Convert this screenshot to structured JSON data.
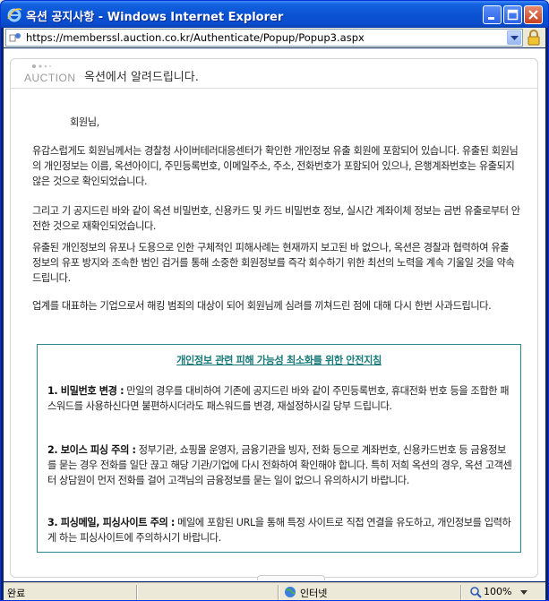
{
  "window": {
    "title": "옥션 공지사항 - Windows Internet Explorer"
  },
  "address": {
    "url": "https://memberssl.auction.co.kr/Authenticate/Popup/Popup3.aspx"
  },
  "header": {
    "logo_text": "AUCTION",
    "title": "옥션에서 알려드립니다."
  },
  "notice": {
    "greeting": "회원님,",
    "p1": "유감스럽게도 회원님께서는 경찰청 사이버테러대응센터가 확인한 개인정보 유출 회원에 포함되어 있습니다. 유출된 회원님의 개인정보는 이름, 옥션아이디, 주민등록번호, 이메일주소, 주소, 전화번호가 포함되어 있으나, 은행계좌번호는 유출되지 않은 것으로 확인되었습니다.",
    "p2": "그리고 기 공지드린 바와 같이 옥션 비밀번호, 신용카드 및 카드 비밀번호 정보, 실시간 계좌이체 정보는 금번 유출로부터 안전한 것으로 재확인되었습니다.",
    "p3": "유출된 개인정보의 유포나 도용으로 인한 구체적인 피해사례는 현재까지 보고된 바 없으나, 옥션은 경찰과 협력하여 유출 정보의 유포 방지와 조속한 범인 검거를 통해 소중한 회원정보를 즉각 회수하기 위한 최선의 노력을 계속 기울일 것을 약속 드립니다.",
    "p4": "업계를 대표하는 기업으로서 해킹 범죄의 대상이 되어 회원님께 심려를 끼쳐드린 점에 대해 다시 한번 사과드립니다."
  },
  "tips": {
    "title": "개인정보 관련 피해 가능성 최소화를 위한 안전지침",
    "items": [
      {
        "heading": "1. 비밀번호 변경 :",
        "text": " 만일의 경우를 대비하여 기존에 공지드린 바와 같이 주민등록번호, 휴대전화 번호 등을 조합한 패스워드를 사용하신다면 불편하시더라도 패스워드를 변경, 재설정하시길 당부 드립니다."
      },
      {
        "heading": "2. 보이스 피싱 주의 :",
        "text": " 정부기관, 쇼핑몰 운영자, 금융기관을 빙자, 전화 등으로 계좌번호, 신용카드번호 등 금융정보를 묻는 경우 전화를 일단 끊고 해당 기관/기업에 다시 전화하여 확인해야 합니다. 특히 저희 옥션의 경우, 옥션 고객센터 상담원이 먼저 전화를 걸어 고객님의 금융정보를 묻는 일이 없으니 유의하시기 바랍니다."
      },
      {
        "heading": "3. 피싱메일, 피싱사이트 주의 :",
        "text": " 메일에 포함된 URL을 통해 특정 사이트로 직접 연결을 유도하고, 개인정보를 입력하게 하는 피싱사이트에 주의하시기 바랍니다."
      }
    ]
  },
  "status": {
    "text": "완료",
    "zone": "인터넷",
    "zoom": "100%"
  },
  "icons": [
    "ie-icon",
    "minimize-icon",
    "maximize-icon",
    "close-icon",
    "page-icon",
    "dropdown-icon",
    "lock-icon",
    "globe-icon",
    "zoom-icon"
  ]
}
